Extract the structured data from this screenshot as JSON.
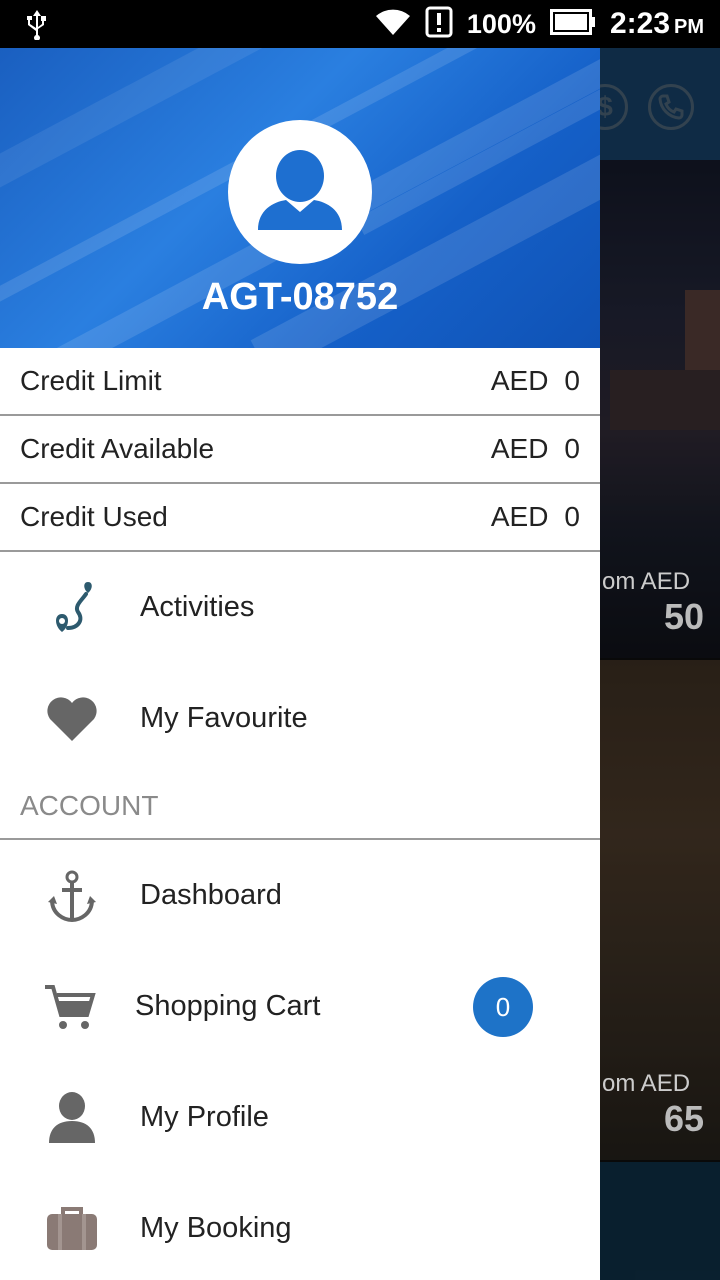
{
  "status_bar": {
    "battery": "100%",
    "time": "2:23",
    "ampm": "PM"
  },
  "drawer": {
    "user_id": "AGT-08752",
    "credits": [
      {
        "label": "Credit Limit",
        "currency": "AED",
        "amount": "0"
      },
      {
        "label": "Credit Available",
        "currency": "AED",
        "amount": "0"
      },
      {
        "label": "Credit Used",
        "currency": "AED",
        "amount": "0"
      }
    ],
    "menu": [
      {
        "label": "Activities",
        "icon": "activities-pin-icon"
      },
      {
        "label": "My Favourite",
        "icon": "heart-icon"
      }
    ],
    "account_section": {
      "title": "ACCOUNT",
      "items": [
        {
          "label": "Dashboard",
          "icon": "anchor-icon"
        },
        {
          "label": "Shopping Cart",
          "icon": "cart-icon",
          "badge": "0"
        },
        {
          "label": "My Profile",
          "icon": "person-icon"
        },
        {
          "label": "My Booking",
          "icon": "briefcase-icon"
        }
      ]
    }
  },
  "background": {
    "price_1_label": "om AED",
    "price_1_value": "50",
    "price_2_label": "om AED",
    "price_2_value": "65",
    "icons": [
      "dollar-icon",
      "phone-icon"
    ]
  },
  "colors": {
    "header_blue": "#1a5fc0",
    "badge_blue": "#1e73c8",
    "icon_gray": "#666666"
  }
}
